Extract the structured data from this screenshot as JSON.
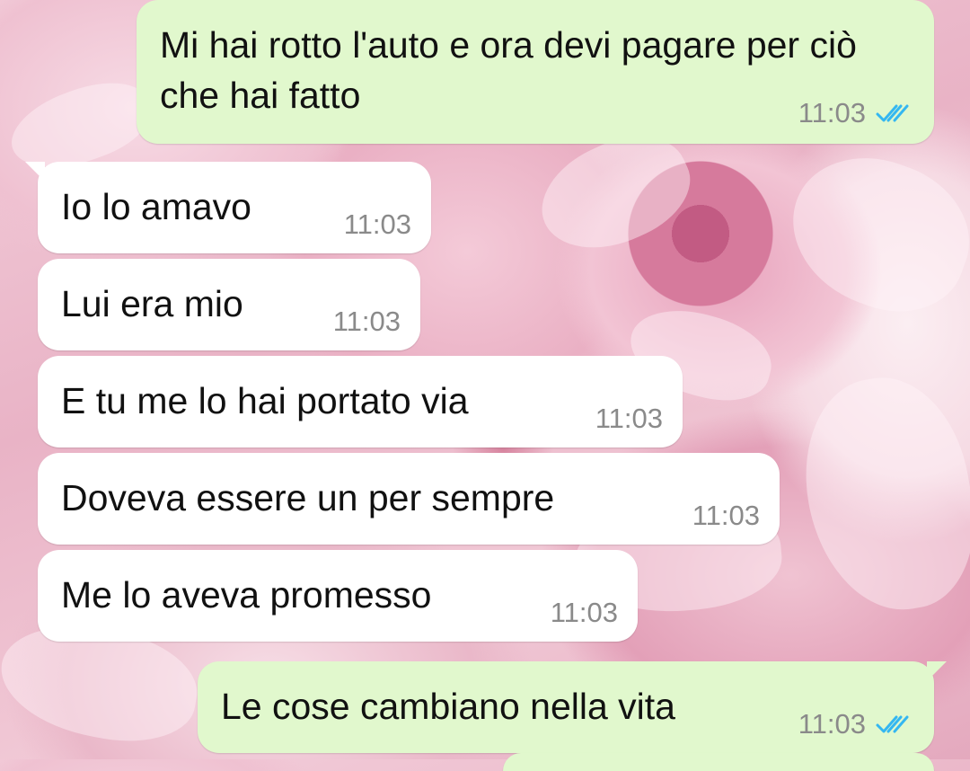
{
  "colors": {
    "incoming_bubble": "#ffffff",
    "outgoing_bubble": "#e1f8cd",
    "read_ticks": "#34b7f1",
    "timestamp": "#8a8a8a"
  },
  "messages": [
    {
      "direction": "outgoing",
      "text": "Mi hai rotto l'auto e ora devi pagare per ciò che hai fatto",
      "time": "11:03",
      "status_icon": "double-check-read-icon"
    },
    {
      "direction": "incoming",
      "text": "Io lo amavo",
      "time": "11:03"
    },
    {
      "direction": "incoming",
      "text": "Lui era mio",
      "time": "11:03"
    },
    {
      "direction": "incoming",
      "text": "E tu me lo hai portato via",
      "time": "11:03"
    },
    {
      "direction": "incoming",
      "text": "Doveva essere un per sempre",
      "time": "11:03"
    },
    {
      "direction": "incoming",
      "text": "Me lo aveva promesso",
      "time": "11:03"
    },
    {
      "direction": "outgoing",
      "text": "Le cose cambiano nella vita",
      "time": "11:03",
      "status_icon": "double-check-read-icon"
    }
  ]
}
